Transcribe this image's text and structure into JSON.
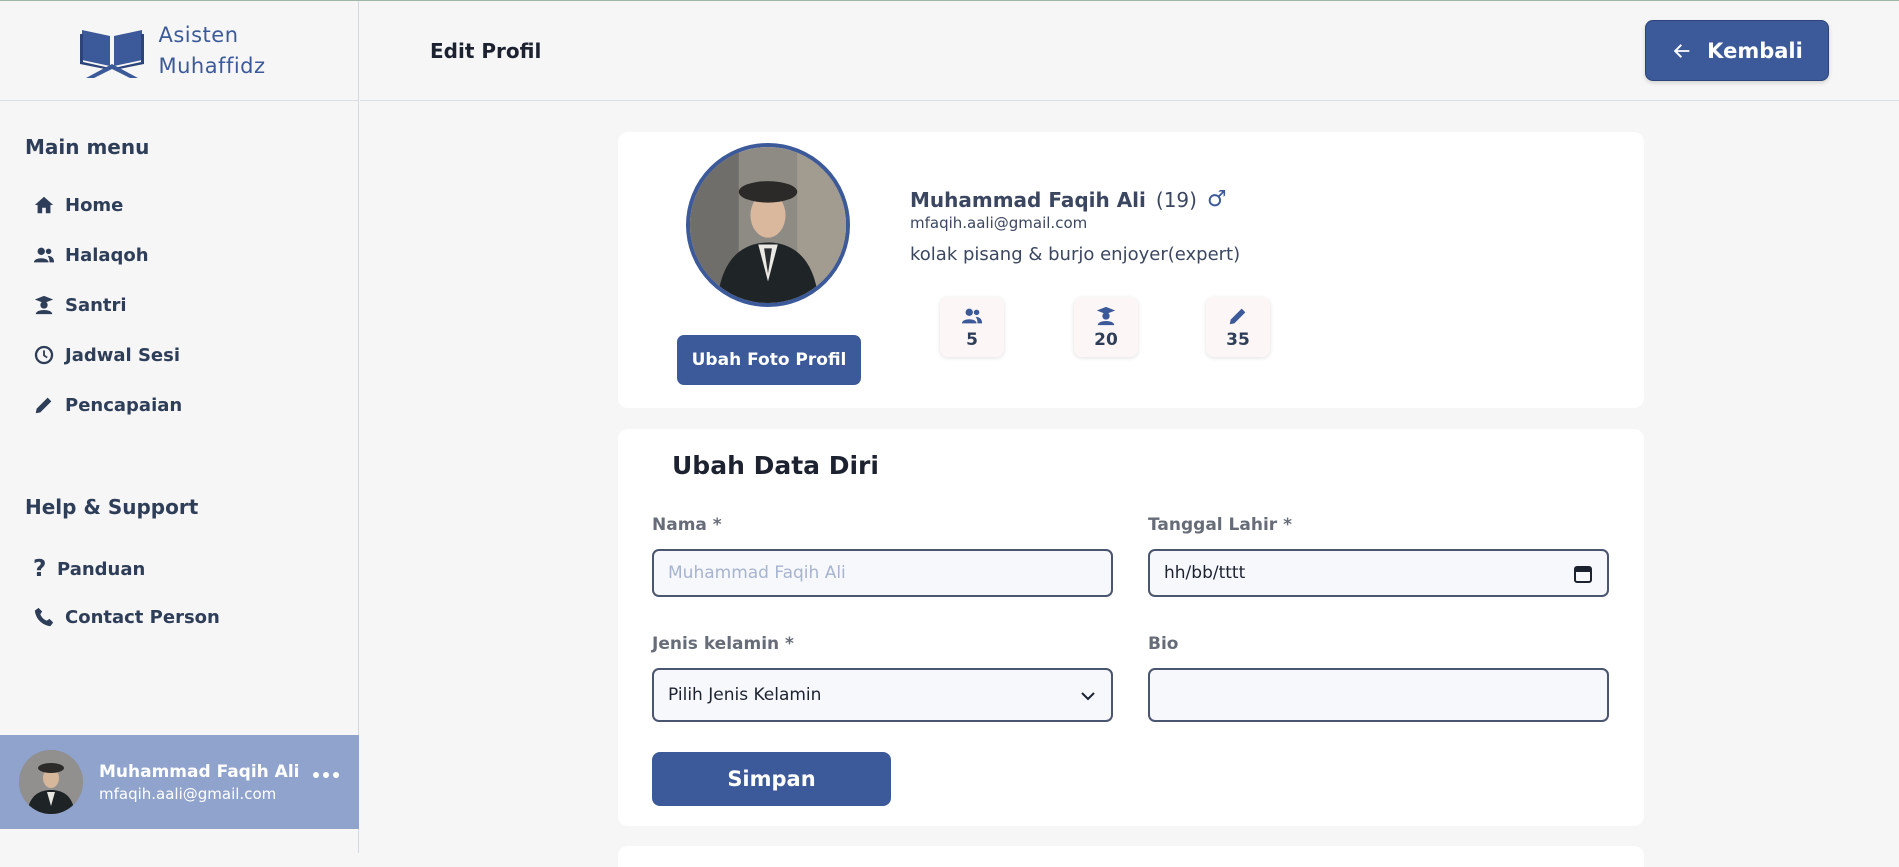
{
  "brand": {
    "line1": "Asisten",
    "line2": "Muhaffidz"
  },
  "sidebar": {
    "main_menu_title": "Main menu",
    "items": [
      {
        "label": "Home",
        "icon": "home-icon"
      },
      {
        "label": "Halaqoh",
        "icon": "users-icon"
      },
      {
        "label": "Santri",
        "icon": "student-icon"
      },
      {
        "label": "Jadwal Sesi",
        "icon": "clock-icon"
      },
      {
        "label": "Pencapaian",
        "icon": "pencil-icon"
      }
    ],
    "help_title": "Help & Support",
    "help_items": [
      {
        "label": "Panduan",
        "icon": "question-icon"
      },
      {
        "label": "Contact Person",
        "icon": "phone-icon"
      }
    ],
    "user": {
      "name": "Muhammad Faqih Ali",
      "email": "mfaqih.aali@gmail.com"
    }
  },
  "header": {
    "title": "Edit Profil",
    "back_label": "Kembali"
  },
  "profile": {
    "name": "Muhammad Faqih Ali",
    "age": "(19)",
    "gender_symbol": "♂",
    "email": "mfaqih.aali@gmail.com",
    "bio": "kolak pisang & burjo enjoyer(expert)",
    "change_photo_label": "Ubah Foto Profil",
    "stats": [
      {
        "icon": "users-icon",
        "value": "5"
      },
      {
        "icon": "student-icon",
        "value": "20"
      },
      {
        "icon": "pencil-icon",
        "value": "35"
      }
    ]
  },
  "form": {
    "title": "Ubah Data Diri",
    "name_label": "Nama *",
    "name_placeholder": "Muhammad Faqih Ali",
    "birth_label": "Tanggal Lahir *",
    "birth_value": "hh/bb/tttt",
    "gender_label": "Jenis kelamin *",
    "gender_value": "Pilih Jenis Kelamin",
    "bio_label": "Bio",
    "bio_value": "",
    "save_label": "Simpan"
  },
  "colors": {
    "primary": "#3c5a99",
    "user_card": "#8fa3cd",
    "background": "#f6f6f7"
  }
}
